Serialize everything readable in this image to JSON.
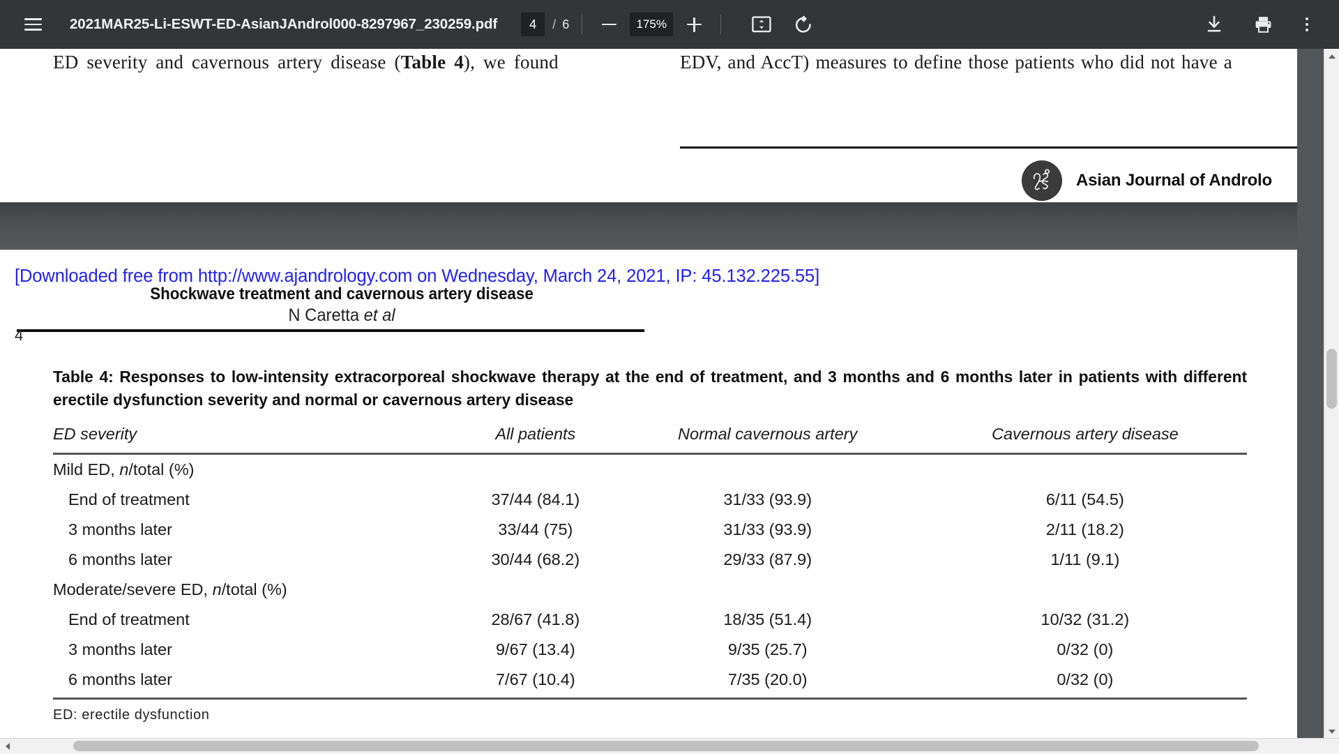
{
  "toolbar": {
    "menu_icon": "hamburger-menu-icon",
    "document_title": "2021MAR25-Li-ESWT-ED-AsianJAndrol000-8297967_230259.pdf",
    "page_number": "4",
    "page_separator": "/",
    "page_count": "6",
    "zoom_out_icon": "minus-icon",
    "zoom_level": "175%",
    "zoom_in_icon": "plus-icon",
    "fit_page_icon": "fit-to-page-icon",
    "rotate_icon": "rotate-counterclockwise-icon",
    "download_icon": "download-icon",
    "print_icon": "print-icon",
    "more_options_icon": "kebab-menu-icon",
    "toolbar_bg": "#323639",
    "input_bg": "#202124"
  },
  "previous_page": {
    "column_left_html": "ED severity and cavernous artery disease (<b>Table 4</b>), we found",
    "column_left_text": "ED severity and cavernous artery disease (Table 4), we found",
    "column_right_text": "EDV, and AccT) measures to define those patients who did not have a",
    "journal_name": "Asian Journal of Androlo",
    "journal_name_full": "Asian Journal of Andrology",
    "logo_icon": "journal-monogram-logo"
  },
  "current_page": {
    "download_notice": "[Downloaded free from http://www.ajandrology.com on Wednesday, March 24, 2021, IP: 45.132.225.55]",
    "download_notice_color": "#2222ee",
    "running_head": "Shockwave treatment and cavernous artery disease",
    "running_author_prefix": "N Caretta ",
    "running_author_suffix": "et al",
    "folio": "4"
  },
  "table": {
    "caption": "Table 4: Responses to low-intensity extracorporeal shockwave therapy at the end of treatment, and 3 months and 6 months later in patients with different erectile dysfunction severity and normal or cavernous artery disease",
    "footnote": "ED: erectile dysfunction",
    "headers": [
      "ED severity",
      "All patients",
      "Normal cavernous artery",
      "Cavernous artery disease"
    ],
    "rows": [
      {
        "type": "group",
        "label_prefix": "Mild ED, ",
        "label_italic": "n",
        "label_suffix": "/total (%)",
        "label": "Mild ED, n/total (%)",
        "values": [
          "",
          "",
          ""
        ]
      },
      {
        "type": "sub",
        "label": "End of treatment",
        "values": [
          "37/44 (84.1)",
          "31/33 (93.9)",
          "6/11 (54.5)"
        ]
      },
      {
        "type": "sub",
        "label": "3 months later",
        "values": [
          "33/44 (75)",
          "31/33 (93.9)",
          "2/11 (18.2)"
        ]
      },
      {
        "type": "sub",
        "label": "6 months later",
        "values": [
          "30/44 (68.2)",
          "29/33 (87.9)",
          "1/11 (9.1)"
        ]
      },
      {
        "type": "group",
        "label_prefix": "Moderate/severe ED, ",
        "label_italic": "n",
        "label_suffix": "/total (%)",
        "label": "Moderate/severe ED, n/total (%)",
        "values": [
          "",
          "",
          ""
        ]
      },
      {
        "type": "sub",
        "label": "End of treatment",
        "values": [
          "28/67 (41.8)",
          "18/35 (51.4)",
          "10/32 (31.2)"
        ]
      },
      {
        "type": "sub",
        "label": "3 months later",
        "values": [
          "9/67 (13.4)",
          "9/35 (25.7)",
          "0/32 (0)"
        ]
      },
      {
        "type": "sub",
        "label": "6 months later",
        "values": [
          "7/67 (10.4)",
          "7/35 (20.0)",
          "0/32 (0)"
        ]
      }
    ]
  },
  "scrollbars": {
    "vertical_up_icon": "scroll-up-arrow-icon",
    "vertical_down_icon": "scroll-down-arrow-icon",
    "horizontal_left_icon": "scroll-left-arrow-icon"
  }
}
